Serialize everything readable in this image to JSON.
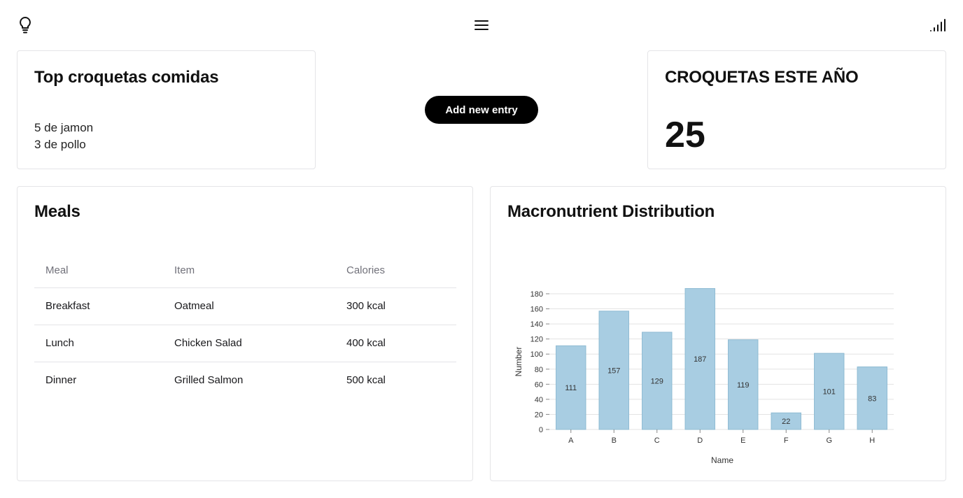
{
  "icons": {
    "left": "lightbulb-icon",
    "center": "hamburger-menu-icon",
    "right": "signal-icon"
  },
  "top_card": {
    "title": "Top croquetas comidas",
    "items": [
      "5 de jamon",
      "3 de pollo"
    ]
  },
  "add_button": {
    "label": "Add new entry"
  },
  "year_card": {
    "title": "CROQUETAS ESTE AÑO",
    "value": "25"
  },
  "meals": {
    "title": "Meals",
    "columns": [
      "Meal",
      "Item",
      "Calories"
    ],
    "rows": [
      [
        "Breakfast",
        "Oatmeal",
        "300 kcal"
      ],
      [
        "Lunch",
        "Chicken Salad",
        "400 kcal"
      ],
      [
        "Dinner",
        "Grilled Salmon",
        "500 kcal"
      ]
    ]
  },
  "macro": {
    "title": "Macronutrient Distribution"
  },
  "chart_data": {
    "type": "bar",
    "categories": [
      "A",
      "B",
      "C",
      "D",
      "E",
      "F",
      "G",
      "H"
    ],
    "values": [
      111,
      157,
      129,
      187,
      119,
      22,
      101,
      83
    ],
    "xlabel": "Name",
    "ylabel": "Number",
    "ylim": [
      0,
      180
    ],
    "yticks": [
      0,
      20,
      40,
      60,
      80,
      100,
      120,
      140,
      160,
      180
    ],
    "grid": true,
    "bar_color": "#a8cde2",
    "bar_stroke": "#8fbbd3"
  },
  "colors": {
    "accent": "#000000",
    "border": "#e4e4e7",
    "muted_text": "#71717a"
  }
}
